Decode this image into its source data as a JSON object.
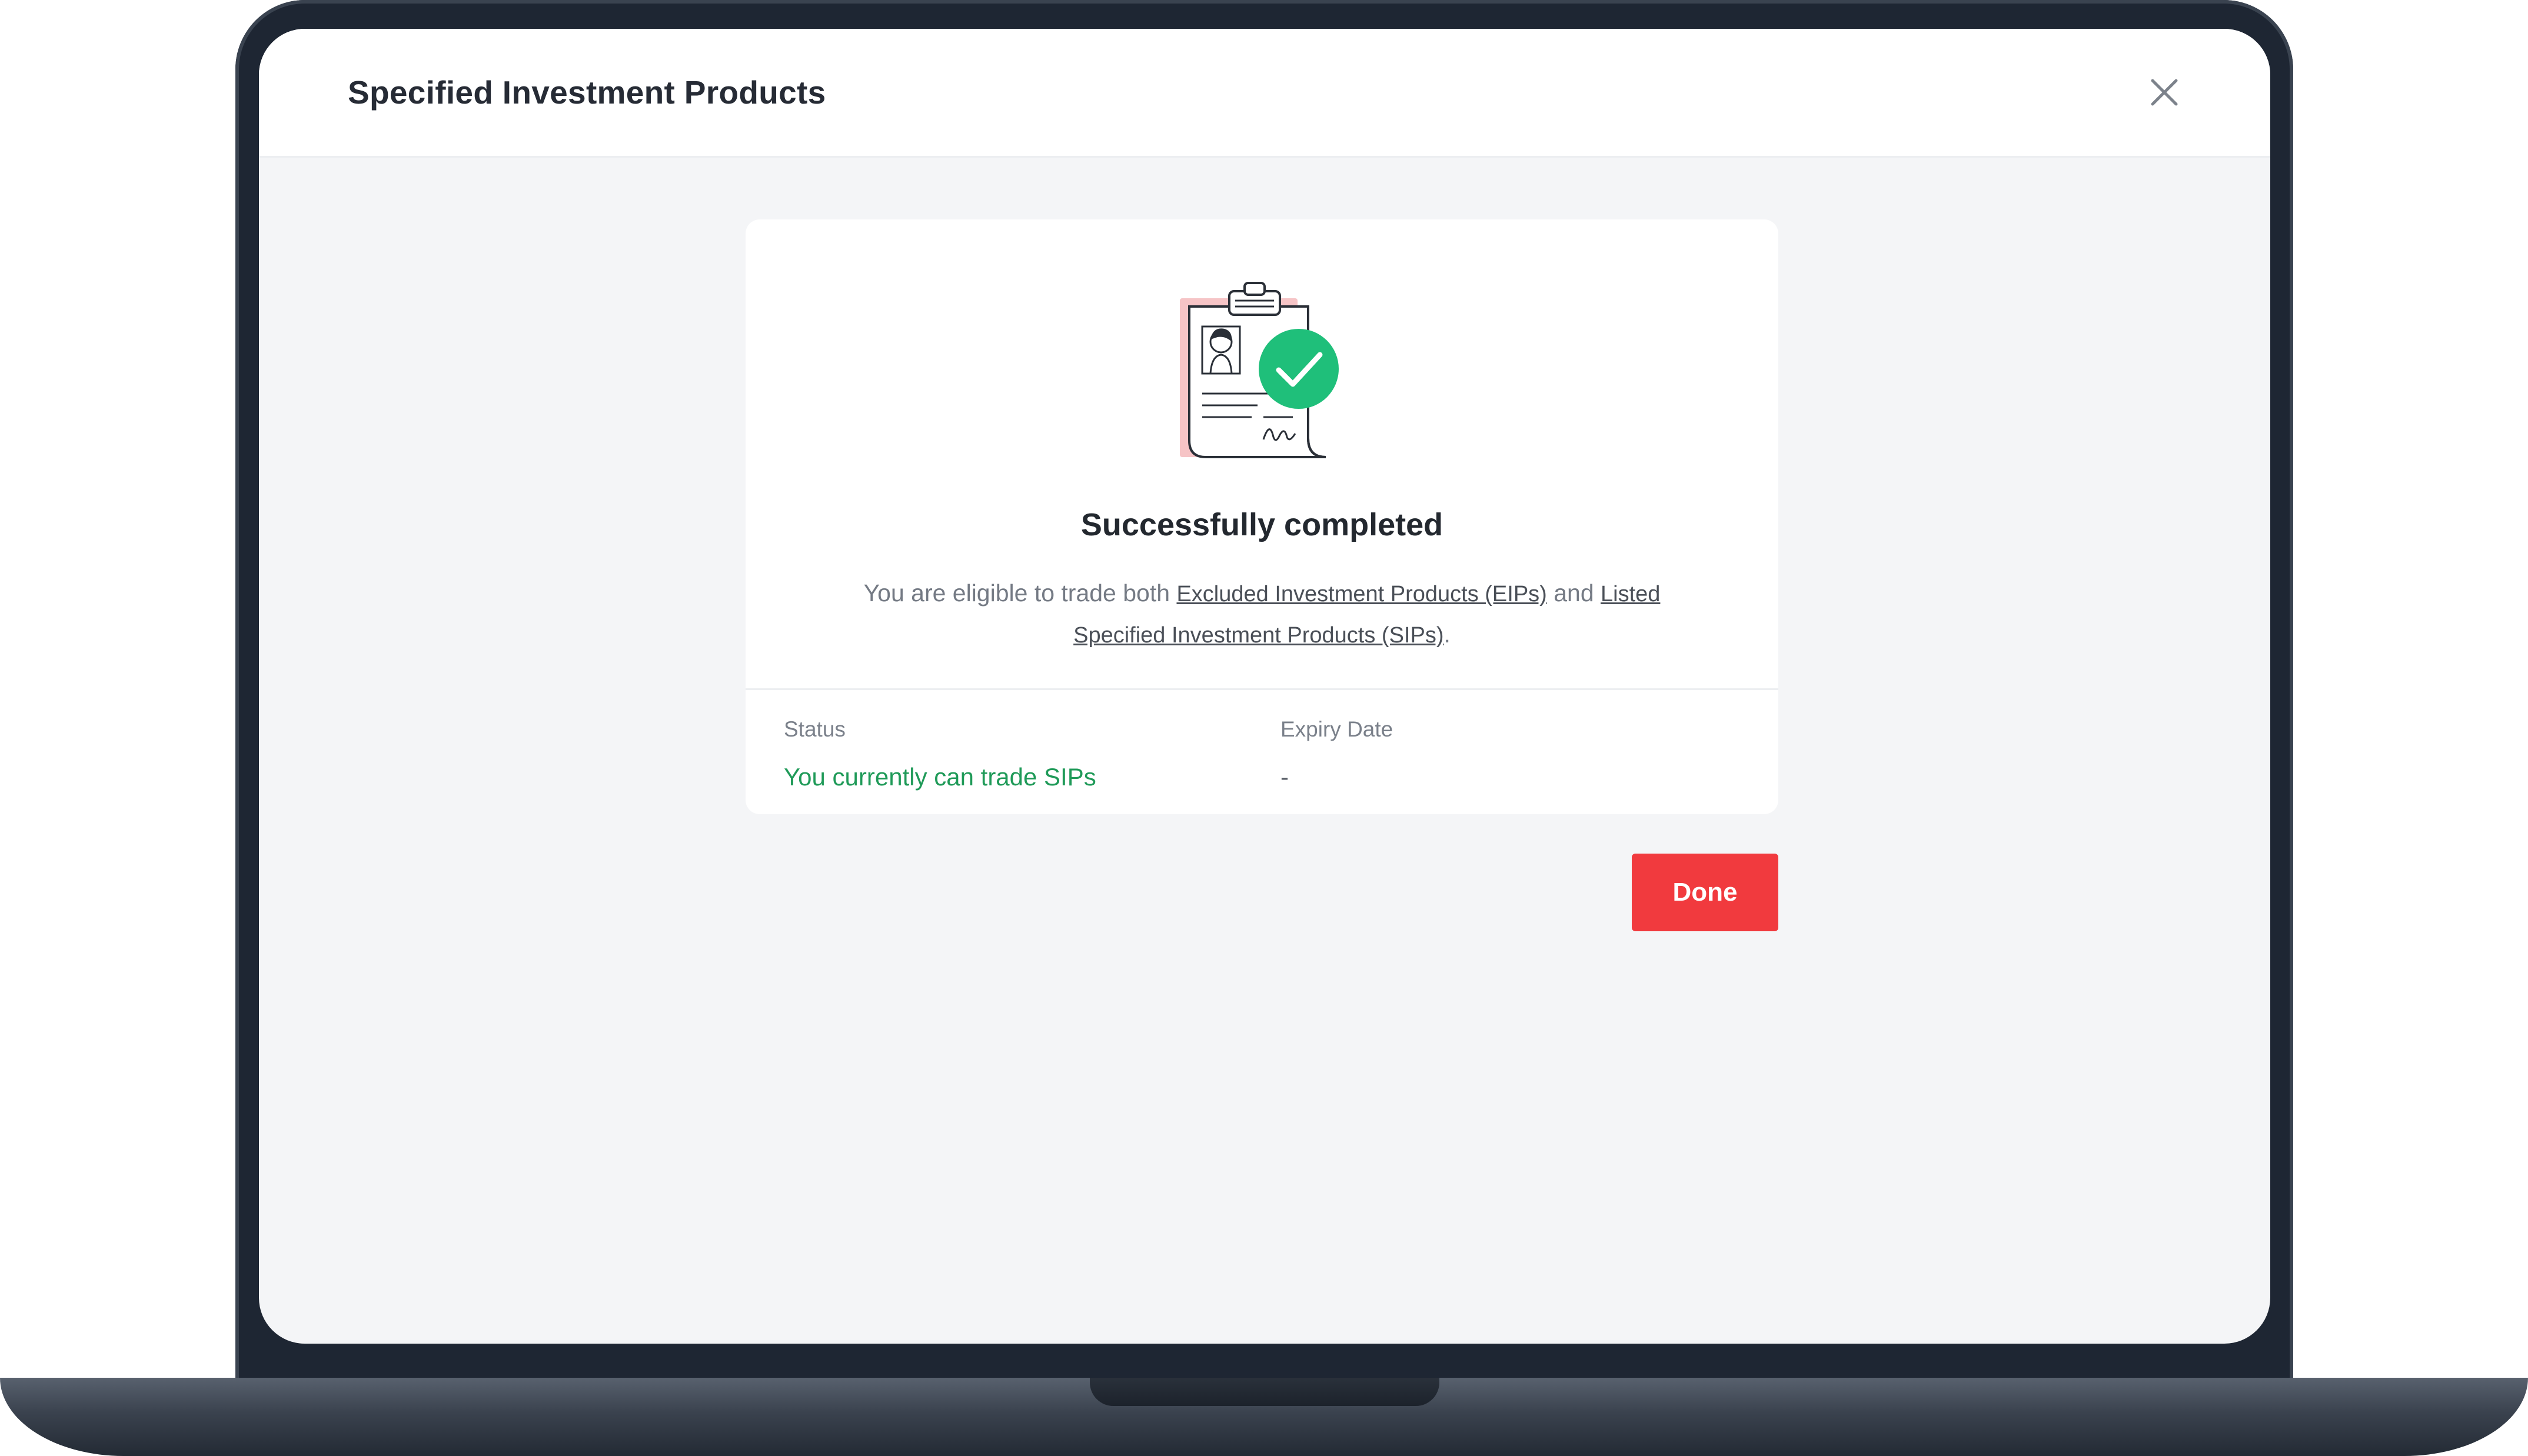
{
  "dialog": {
    "title": "Specified Investment Products",
    "close_icon": "close-icon"
  },
  "result": {
    "illustration_icon": "clipboard-check-icon",
    "headline": "Successfully completed",
    "description": {
      "prefix": "You are eligible to trade both ",
      "link_eip": "Excluded Investment Products (EIPs)",
      "middle": " and ",
      "link_sip": "Listed Specified Investment Products (SIPs)",
      "suffix": "."
    },
    "status_label": "Status",
    "status_value": "You currently can trade SIPs",
    "expiry_label": "Expiry Date",
    "expiry_value": "-"
  },
  "actions": {
    "done_label": "Done"
  },
  "colors": {
    "accent": "#f13a3e",
    "success": "#1f9a58",
    "check_badge": "#1fbf7a"
  }
}
